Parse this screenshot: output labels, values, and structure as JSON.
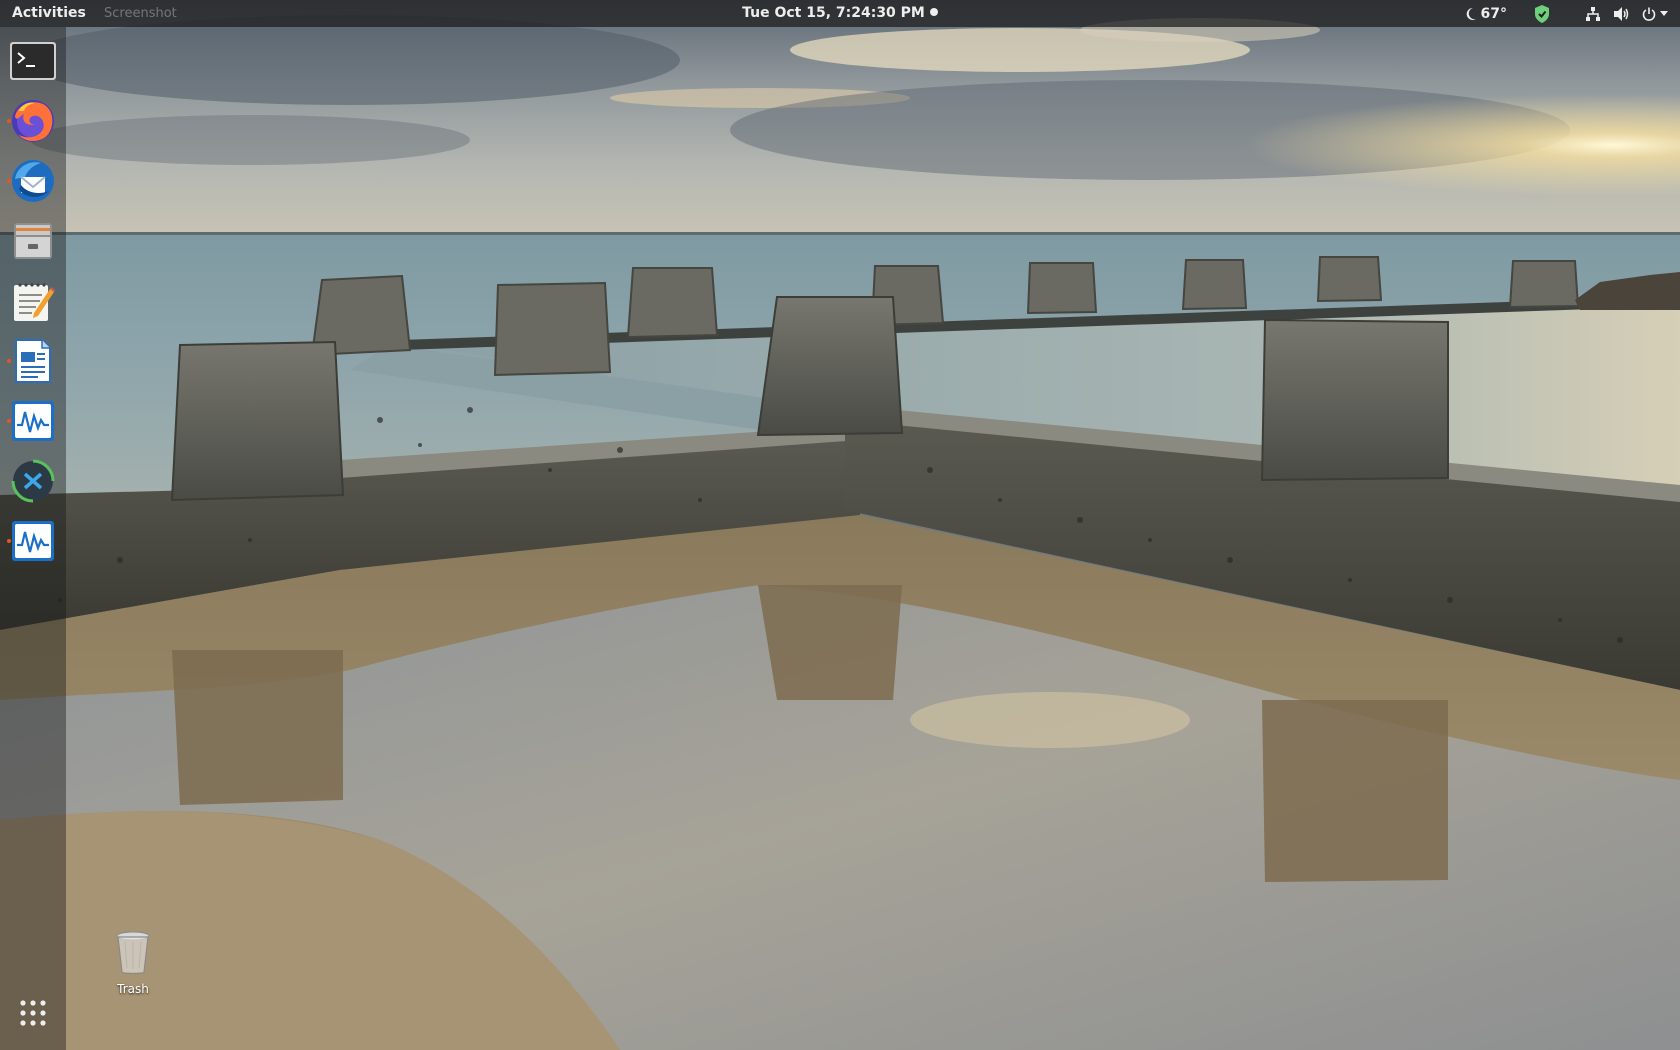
{
  "topbar": {
    "activities_label": "Activities",
    "app_menu_label": "Screenshot",
    "clock": "Tue Oct 15,  7:24:30 PM",
    "weather_temp": "67°",
    "icons": [
      "moon-icon",
      "shield-check-icon",
      "network-icon",
      "volume-icon",
      "power-icon"
    ]
  },
  "dock": {
    "items": [
      {
        "name": "Terminal",
        "icon": "terminal-icon",
        "running": false
      },
      {
        "name": "Firefox",
        "icon": "firefox-icon",
        "running": true
      },
      {
        "name": "Thunderbird",
        "icon": "thunderbird-icon",
        "running": true
      },
      {
        "name": "Files",
        "icon": "files-icon",
        "running": false
      },
      {
        "name": "Text Editor",
        "icon": "text-editor-icon",
        "running": false
      },
      {
        "name": "LibreOffice Writer",
        "icon": "writer-icon",
        "running": true
      },
      {
        "name": "System Monitor",
        "icon": "system-monitor-icon",
        "running": true
      },
      {
        "name": "Remote Desktop",
        "icon": "remote-desktop-icon",
        "running": false
      },
      {
        "name": "System Monitor",
        "icon": "system-monitor-icon",
        "running": true
      }
    ],
    "show_apps_icon": "apps-grid-icon"
  },
  "desktop": {
    "trash_label": "Trash"
  },
  "colors": {
    "topbar_bg": "#1c1c1c",
    "running_indicator": "#e95420",
    "text_light": "#eeeeec"
  }
}
